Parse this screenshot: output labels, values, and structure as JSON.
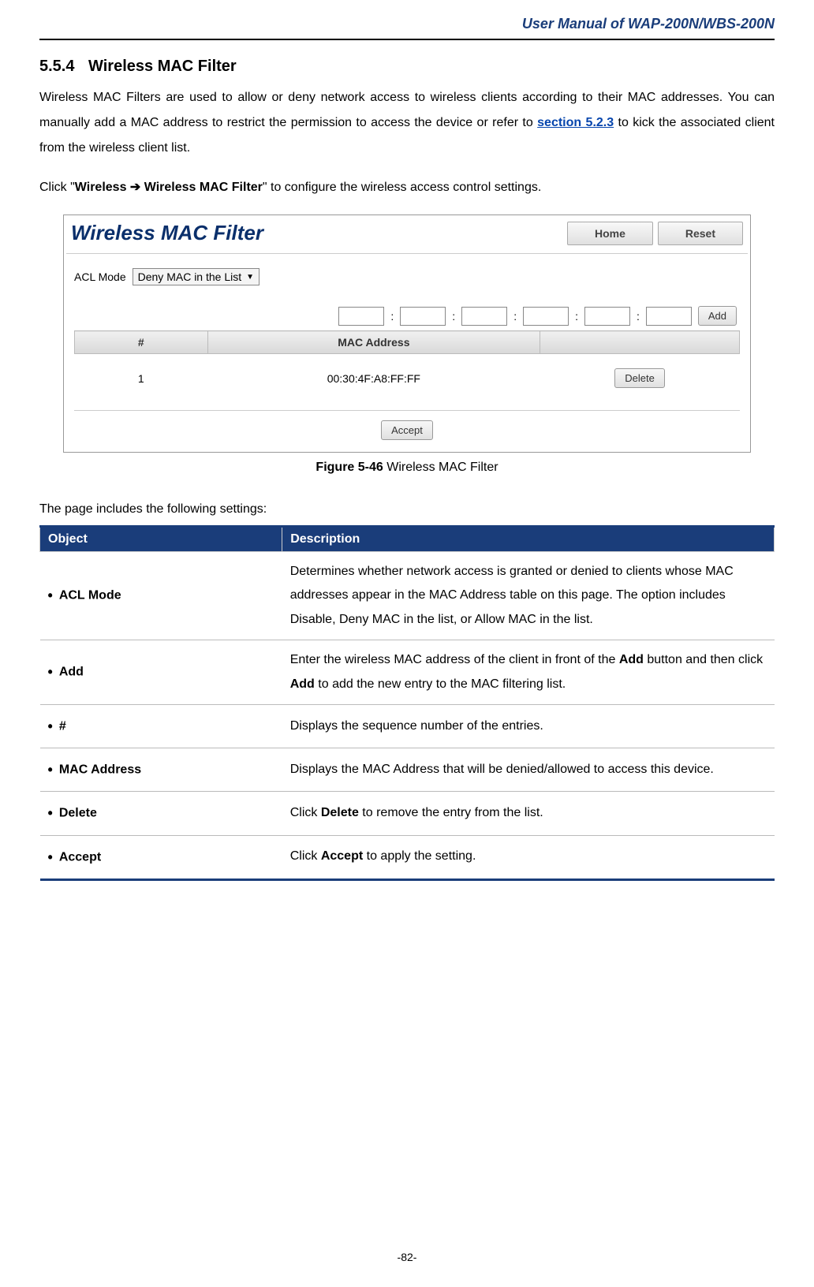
{
  "header": {
    "doc_title": "User Manual of WAP-200N/WBS-200N"
  },
  "section": {
    "number": "5.5.4",
    "title": "Wireless MAC Filter"
  },
  "intro_paragraph": {
    "part1": "Wireless MAC Filters are used to allow or deny network access to wireless clients according to their MAC addresses. You can manually add a MAC address to restrict the permission to access the device or refer to ",
    "link": "section 5.2.3",
    "part2": " to kick the associated client from the wireless client list."
  },
  "click_line": {
    "prefix": "Click \"",
    "bold1": "Wireless ",
    "arrow": "➔",
    "bold2": " Wireless MAC Filter",
    "suffix": "\" to configure the wireless access control settings."
  },
  "screenshot": {
    "title": "Wireless MAC Filter",
    "home_btn": "Home",
    "reset_btn": "Reset",
    "acl_label": "ACL Mode",
    "acl_value": "Deny MAC in the List",
    "add_btn": "Add",
    "table_headers": {
      "num": "#",
      "mac": "MAC Address"
    },
    "rows": [
      {
        "num": "1",
        "mac": "00:30:4F:A8:FF:FF"
      }
    ],
    "delete_btn": "Delete",
    "accept_btn": "Accept"
  },
  "figure_caption": {
    "label": "Figure 5-46",
    "text": " Wireless MAC Filter"
  },
  "settings_intro": "The page includes the following settings:",
  "settings_table": {
    "headers": {
      "object": "Object",
      "description": "Description"
    },
    "rows": [
      {
        "object": "ACL Mode",
        "desc_parts": [
          {
            "t": "Determines whether network access is granted or denied to clients whose MAC addresses appear in the MAC Address table on this page. The option includes Disable, Deny MAC in the list, or Allow MAC in the list."
          }
        ]
      },
      {
        "object": "Add",
        "desc_parts": [
          {
            "t": "Enter the wireless MAC address of the client in front of the "
          },
          {
            "t": "Add",
            "b": true
          },
          {
            "t": " button and then click "
          },
          {
            "t": "Add",
            "b": true
          },
          {
            "t": " to add the new entry to the MAC filtering list."
          }
        ]
      },
      {
        "object": "#",
        "desc_parts": [
          {
            "t": "Displays the sequence number of the entries."
          }
        ]
      },
      {
        "object": "MAC Address",
        "desc_parts": [
          {
            "t": "Displays the MAC Address that will be denied/allowed to access this device."
          }
        ]
      },
      {
        "object": "Delete",
        "desc_parts": [
          {
            "t": "Click "
          },
          {
            "t": "Delete",
            "b": true
          },
          {
            "t": " to remove the entry from the list."
          }
        ]
      },
      {
        "object": "Accept",
        "desc_parts": [
          {
            "t": "Click "
          },
          {
            "t": "Accept",
            "b": true
          },
          {
            "t": " to apply the setting."
          }
        ]
      }
    ]
  },
  "footer": {
    "page": "-82-"
  }
}
